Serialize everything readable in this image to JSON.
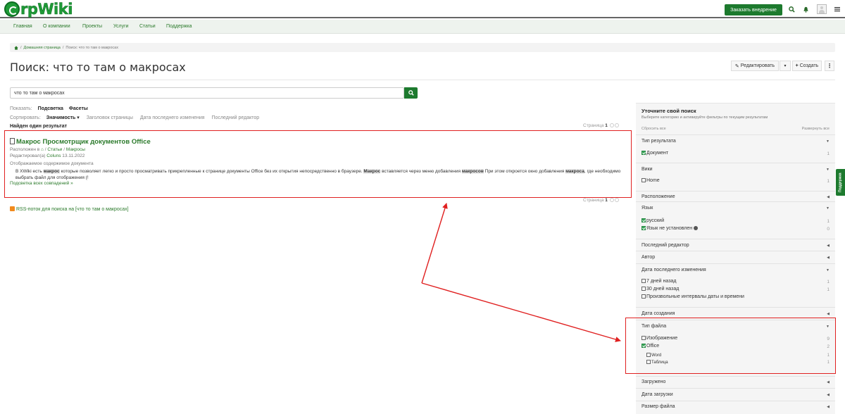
{
  "header": {
    "logo_text": "rpWiki",
    "order_button": "Заказать внедрение",
    "icons": [
      "search-icon",
      "bell-icon",
      "avatar",
      "menu-icon"
    ]
  },
  "nav": [
    "Главная",
    "О компании",
    "Проекты",
    "Услуги",
    "Статьи",
    "Поддержка"
  ],
  "breadcrumb": {
    "sep": "/",
    "items": [
      "Домашняя страница",
      "Поиск: что то там о макросах"
    ]
  },
  "page": {
    "title": "Поиск: что то там о макросах",
    "edit_button": "Редактировать",
    "create_button": "Создать"
  },
  "search": {
    "value": "что то там о макросах"
  },
  "show": {
    "label": "Показать:",
    "options": [
      "Подсветка",
      "Фасеты"
    ]
  },
  "sort": {
    "label": "Сортировать:",
    "active": "Значимость",
    "options": [
      "Заголовок страницы",
      "Дата последнего изменения",
      "Последний редактор"
    ]
  },
  "found_text": "Найден один результат",
  "paging": {
    "label": "Страница",
    "current": "1"
  },
  "result": {
    "title": "Макрос Просмотрщик документов Office",
    "location_label": "Расположен в",
    "location": [
      "Статьи",
      "Макросы"
    ],
    "edited_label": "Редактировал(а)",
    "editor": "Coluns",
    "date": "13.11.2022",
    "content_label": "Отображаемое содержимое документа",
    "snippet_parts": [
      "В XWiki есть ",
      "макрос",
      " которые позволяет легко и просто просматривать прикрепленные к странице документы Office без их открытия непосредственно в браузере. ",
      "Макрос",
      " вставляется через меню добавления ",
      "макросов",
      " При этом откроется окно добавления ",
      "макроса",
      ", где необходимо выбрать файл для отображения (!"
    ],
    "highlight_link": "Подсветка всех совпадений »"
  },
  "rss_text": "RSS-поток для поиска на [что то там о макросах]",
  "sidebar": {
    "title": "Уточните свой поиск",
    "subtitle": "Выберите категорию и активируйте фильтры по текущим результатам",
    "reset": "Сбросить все",
    "expand": "Развернуть все",
    "sections": {
      "result_type": {
        "title": "Тип результата",
        "items": [
          {
            "label": "Документ",
            "count": "1",
            "checked": true
          }
        ]
      },
      "wiki": {
        "title": "Вики",
        "items": [
          {
            "label": "Home",
            "count": "1",
            "checked": false
          }
        ]
      },
      "location": {
        "title": "Расположение"
      },
      "language": {
        "title": "Язык",
        "items": [
          {
            "label": "русский",
            "count": "1",
            "checked": true
          },
          {
            "label": "Язык не установлен",
            "count": "0",
            "checked": true
          }
        ]
      },
      "last_editor": {
        "title": "Последний редактор"
      },
      "author": {
        "title": "Автор"
      },
      "last_modified": {
        "title": "Дата последнего изменения",
        "items": [
          {
            "label": "7 дней назад",
            "count": "1",
            "checked": false
          },
          {
            "label": "30 дней назад",
            "count": "1",
            "checked": false
          },
          {
            "label": "Произвольные интервалы даты и времени",
            "count": "",
            "checked": false
          }
        ]
      },
      "created": {
        "title": "Дата создания"
      },
      "file_type": {
        "title": "Тип файла",
        "items": [
          {
            "label": "Изображение",
            "count": "9",
            "checked": false
          },
          {
            "label": "Office",
            "count": "2",
            "checked": true
          }
        ],
        "subitems": [
          {
            "label": "Word",
            "count": "1"
          },
          {
            "label": "Таблица",
            "count": "1"
          }
        ]
      },
      "uploaded": {
        "title": "Загружено"
      },
      "upload_date": {
        "title": "Дата загрузки"
      },
      "file_size": {
        "title": "Размер файла"
      }
    }
  },
  "support_tab": "Поддержка",
  "colors": {
    "brand": "#1d7a2e",
    "annotation": "#e02020",
    "link": "#2b7a2b"
  }
}
